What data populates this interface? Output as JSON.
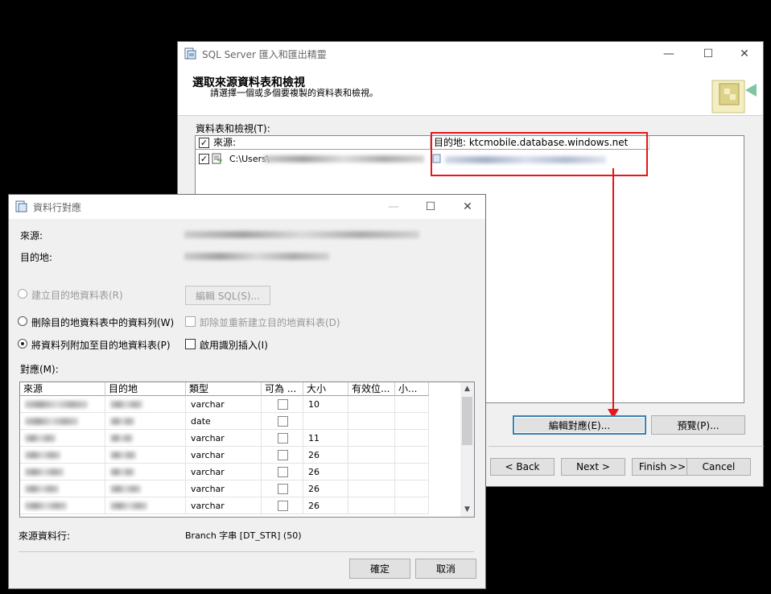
{
  "main_window": {
    "title": "SQL Server 匯入和匯出精靈",
    "header_title": "選取來源資料表和檢視",
    "header_subtitle": "請選擇一個或多個要複製的資料表和檢視。",
    "tables_label": "資料表和檢視(T):",
    "col_source": "來源:",
    "col_destination": "目的地: ktcmobile.database.windows.net",
    "row_source_prefix": "C:\\Users\\",
    "edit_mapping_button": "編輯對應(E)...",
    "preview_button": "預覽(P)...",
    "back_button": "< Back",
    "next_button": "Next >",
    "finish_button": "Finish >>|",
    "cancel_button": "Cancel"
  },
  "mapping_dialog": {
    "title": "資料行對應",
    "source_label": "來源:",
    "destination_label": "目的地:",
    "option_create": "建立目的地資料表(R)",
    "edit_sql_button": "編輯 SQL(S)...",
    "option_delete": "刪除目的地資料表中的資料列(W)",
    "drop_recreate": "卸除並重新建立目的地資料表(D)",
    "option_append": "將資料列附加至目的地資料表(P)",
    "identity_insert": "啟用識別插入(I)",
    "mappings_label": "對應(M):",
    "columns": [
      "來源",
      "目的地",
      "類型",
      "可為 ...",
      "大小",
      "有效位...",
      "小..."
    ],
    "rows": [
      {
        "type": "varchar",
        "size": "10"
      },
      {
        "type": "date",
        "size": ""
      },
      {
        "type": "varchar",
        "size": "11"
      },
      {
        "type": "varchar",
        "size": "26"
      },
      {
        "type": "varchar",
        "size": "26"
      },
      {
        "type": "varchar",
        "size": "26"
      },
      {
        "type": "varchar",
        "size": "26"
      }
    ],
    "source_column_label": "來源資料行:",
    "source_column_value": "Branch 字串 [DT_STR] (50)",
    "ok_button": "確定",
    "cancel_button": "取消"
  },
  "colors": {
    "highlight": "#e8151b",
    "window_bg": "#f0f0f0",
    "default_border": "#3c7fb1"
  }
}
